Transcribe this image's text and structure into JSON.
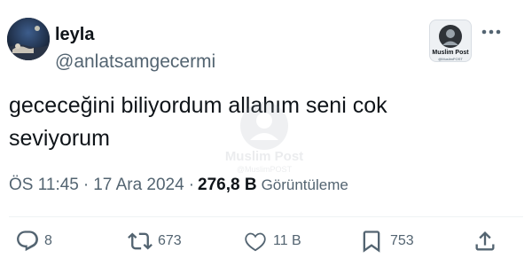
{
  "user": {
    "display_name": "leyla",
    "handle": "@anlatsamgecermi",
    "avatar_icon": "profile-avatar-icon"
  },
  "badge": {
    "title": "Muslim Post",
    "subtitle": "@MuslimPOST",
    "icon": "muslim-post-logo-icon"
  },
  "tweet": {
    "line1": "gececeğini biliyordum allahım seni cok",
    "line2": "seviyorum"
  },
  "meta": {
    "time": "ÖS 11:45",
    "separator1": "·",
    "date": "17 Ara 2024",
    "separator2": "·",
    "views_count": "276,8 B",
    "views_label": "Görüntüleme"
  },
  "watermark": {
    "title": "Muslim Post",
    "subtitle": "@MuslimPOST"
  },
  "actions": {
    "reply": {
      "count": "8",
      "icon": "reply-icon"
    },
    "retweet": {
      "count": "673",
      "icon": "retweet-icon"
    },
    "like": {
      "count": "11 B",
      "icon": "heart-icon"
    },
    "bookmark": {
      "count": "753",
      "icon": "bookmark-icon"
    },
    "share": {
      "icon": "share-icon"
    }
  },
  "colors": {
    "text": "#0f1419",
    "secondary": "#536471",
    "divider": "#eff3f4"
  }
}
